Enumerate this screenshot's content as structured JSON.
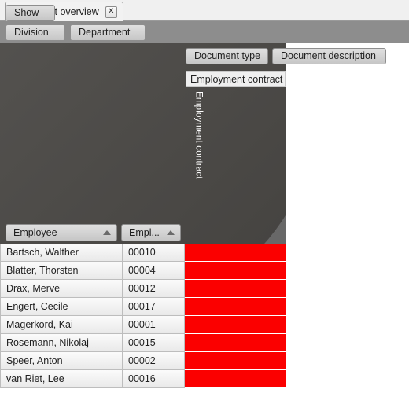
{
  "window": {
    "tab": {
      "title": "Document overview",
      "close_icon": "close-icon",
      "close_glyph": "✕"
    }
  },
  "toolbar": {
    "division_label": "Division",
    "department_label": "Department"
  },
  "matrix": {
    "show_label": "Show",
    "column_headers": [
      {
        "label": "Document type"
      },
      {
        "label": "Document description"
      }
    ],
    "column_value": "Employment contract",
    "vertical_label": "Employment contract",
    "row_headers": [
      {
        "label": "Employee",
        "sort": "asc",
        "sort_icon": "sort-ascending-icon"
      },
      {
        "label": "Empl...",
        "sort": "asc",
        "sort_icon": "sort-ascending-icon"
      }
    ]
  },
  "grid": {
    "rows": [
      {
        "employee": "Bartsch, Walther",
        "number": "00010",
        "flag": "red"
      },
      {
        "employee": "Blatter, Thorsten",
        "number": "00004",
        "flag": "red"
      },
      {
        "employee": "Drax, Merve",
        "number": "00012",
        "flag": "red"
      },
      {
        "employee": "Engert, Cecile",
        "number": "00017",
        "flag": "red"
      },
      {
        "employee": "Magerkord, Kai",
        "number": "00001",
        "flag": "red"
      },
      {
        "employee": "Rosemann, Nikolaj",
        "number": "00015",
        "flag": "red"
      },
      {
        "employee": "Speer, Anton",
        "number": "00002",
        "flag": "red"
      },
      {
        "employee": "van Riet, Lee",
        "number": "00016",
        "flag": "red"
      }
    ]
  },
  "colors": {
    "flag_red": "#fb0000",
    "toolbar_gray": "#8d8d8d",
    "matrix_outer": "#757575",
    "matrix_mid": "#6e6e6e",
    "matrix_inner": "#4a4845"
  }
}
